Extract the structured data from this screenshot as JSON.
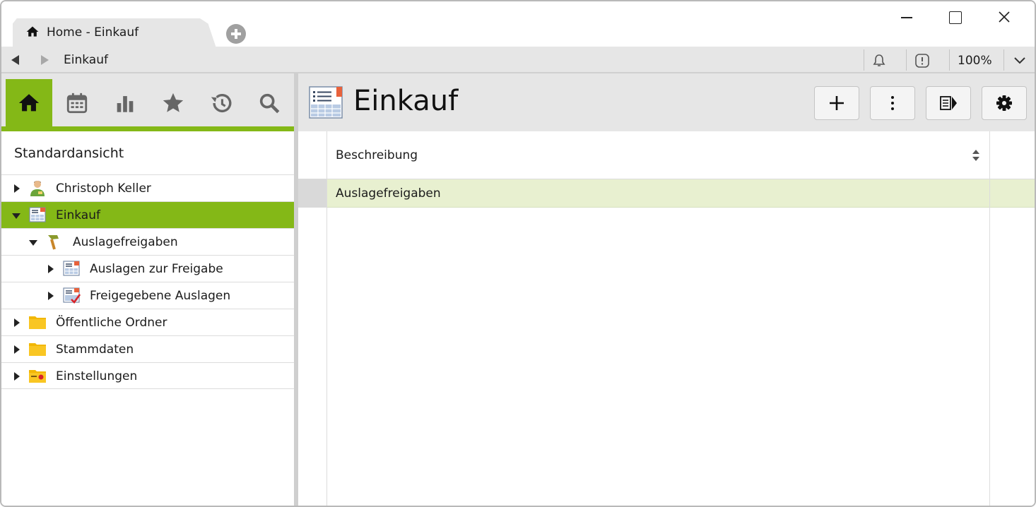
{
  "tab": {
    "title": "Home - Einkauf",
    "icon": "home-icon"
  },
  "address": {
    "path": "Einkauf",
    "zoom": "100%"
  },
  "sidebar": {
    "tools": [
      {
        "name": "home-icon",
        "active": true
      },
      {
        "name": "calendar-icon",
        "active": false
      },
      {
        "name": "bar-chart-icon",
        "active": false
      },
      {
        "name": "star-icon",
        "active": false
      },
      {
        "name": "history-icon",
        "active": false
      },
      {
        "name": "search-icon",
        "active": false
      }
    ],
    "view_title": "Standardansicht",
    "tree": [
      {
        "label": "Christoph Keller",
        "icon": "user-icon",
        "expanded": false,
        "selected": false,
        "level": 0
      },
      {
        "label": "Einkauf",
        "icon": "form-icon",
        "expanded": true,
        "selected": true,
        "level": 0
      },
      {
        "label": "Auslagefreigaben",
        "icon": "hammer-icon",
        "expanded": true,
        "selected": false,
        "level": 1
      },
      {
        "label": "Auslagen zur Freigabe",
        "icon": "form-icon",
        "expanded": false,
        "selected": false,
        "level": 2
      },
      {
        "label": "Freigegebene Auslagen",
        "icon": "form-check-icon",
        "expanded": false,
        "selected": false,
        "level": 2
      },
      {
        "label": "Öffentliche Ordner",
        "icon": "folder-icon",
        "expanded": false,
        "selected": false,
        "level": 0
      },
      {
        "label": "Stammdaten",
        "icon": "folder-icon",
        "expanded": false,
        "selected": false,
        "level": 0
      },
      {
        "label": "Einstellungen",
        "icon": "folder-settings-icon",
        "expanded": false,
        "selected": false,
        "level": 0
      }
    ]
  },
  "main": {
    "title": "Einkauf",
    "buttons": [
      "add-icon",
      "more-vertical-icon",
      "details-panel-icon",
      "gear-icon"
    ],
    "grid": {
      "columns": [
        "Beschreibung"
      ],
      "rows": [
        [
          "Auslagefreigaben"
        ]
      ]
    }
  },
  "colors": {
    "accent": "#84b817",
    "row_selected": "#e8f0d0",
    "toolbar_bg": "#e6e6e6"
  }
}
